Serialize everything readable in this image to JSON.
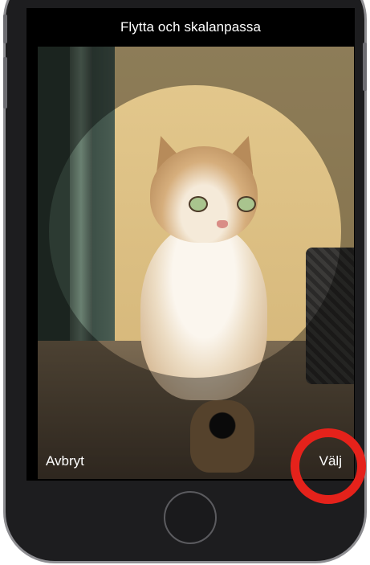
{
  "screen": {
    "title": "Flytta och skalanpassa",
    "photo_description_icon": "cat-photo"
  },
  "actions": {
    "cancel_label": "Avbryt",
    "choose_label": "Välj"
  },
  "colors": {
    "highlight": "#e5221b",
    "screen_background": "#000000",
    "text": "#ffffff"
  }
}
